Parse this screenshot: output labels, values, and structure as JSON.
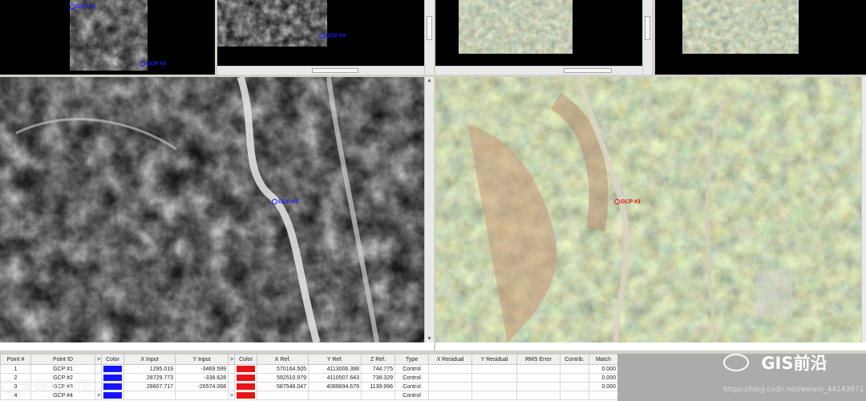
{
  "gcp_labels": {
    "p1": "GCP #1",
    "p2": "GCP #3",
    "p3": "GCP #3",
    "p4": "GCP #3",
    "p5": "GCP #3"
  },
  "table": {
    "headers": [
      "Point #",
      "Point ID",
      ">",
      "Color",
      "X Input",
      "Y Input",
      ">",
      "Color",
      "X Ref.",
      "Y Ref.",
      "Z Ref.",
      "Type",
      "X Residual",
      "Y Residual",
      "RMS Error",
      "Contrib.",
      "Match"
    ],
    "rows": [
      {
        "point": "1",
        "id": "GCP #1",
        "arrow": "",
        "x_input": "1295.019",
        "y_input": "-3469.599",
        "arrow2": "",
        "x_ref": "570164.505",
        "y_ref": "4113006.388",
        "z_ref": "744.775",
        "type": "Control",
        "x_res": "",
        "y_res": "",
        "rms": "",
        "contrib": "",
        "match": "0.000"
      },
      {
        "point": "2",
        "id": "GCP #2",
        "arrow": "",
        "x_input": "28729.773",
        "y_input": "-338.628",
        "arrow2": "",
        "x_ref": "592510.979",
        "y_ref": "4110507.643",
        "z_ref": "738.329",
        "type": "Control",
        "x_res": "",
        "y_res": "",
        "rms": "",
        "contrib": "",
        "match": "0.000"
      },
      {
        "point": "3",
        "id": "GCP #3",
        "arrow": "",
        "x_input": "28607.717",
        "y_input": "-26574.068",
        "arrow2": "",
        "x_ref": "587548.047",
        "y_ref": "4089694.679",
        "z_ref": "1139.996",
        "type": "Control",
        "x_res": "",
        "y_res": "",
        "rms": "",
        "contrib": "",
        "match": "0.000"
      },
      {
        "point": "4",
        "id": "GCP #4",
        "arrow": ">",
        "x_input": "",
        "y_input": "",
        "arrow2": ">",
        "x_ref": "",
        "y_ref": "",
        "z_ref": "",
        "type": "Control",
        "x_res": "",
        "y_res": "",
        "rms": "",
        "contrib": "",
        "match": ""
      }
    ]
  },
  "watermarks": {
    "left_text": "大数据中国",
    "right_text": "GIS前沿",
    "url": "https://blog.csdn.net/weixin_44143671"
  },
  "colors": {
    "input_gcp": "#1a1aff",
    "ref_gcp": "#e01010",
    "input_swatch": "#1414ff",
    "ref_swatch": "#e61414"
  }
}
